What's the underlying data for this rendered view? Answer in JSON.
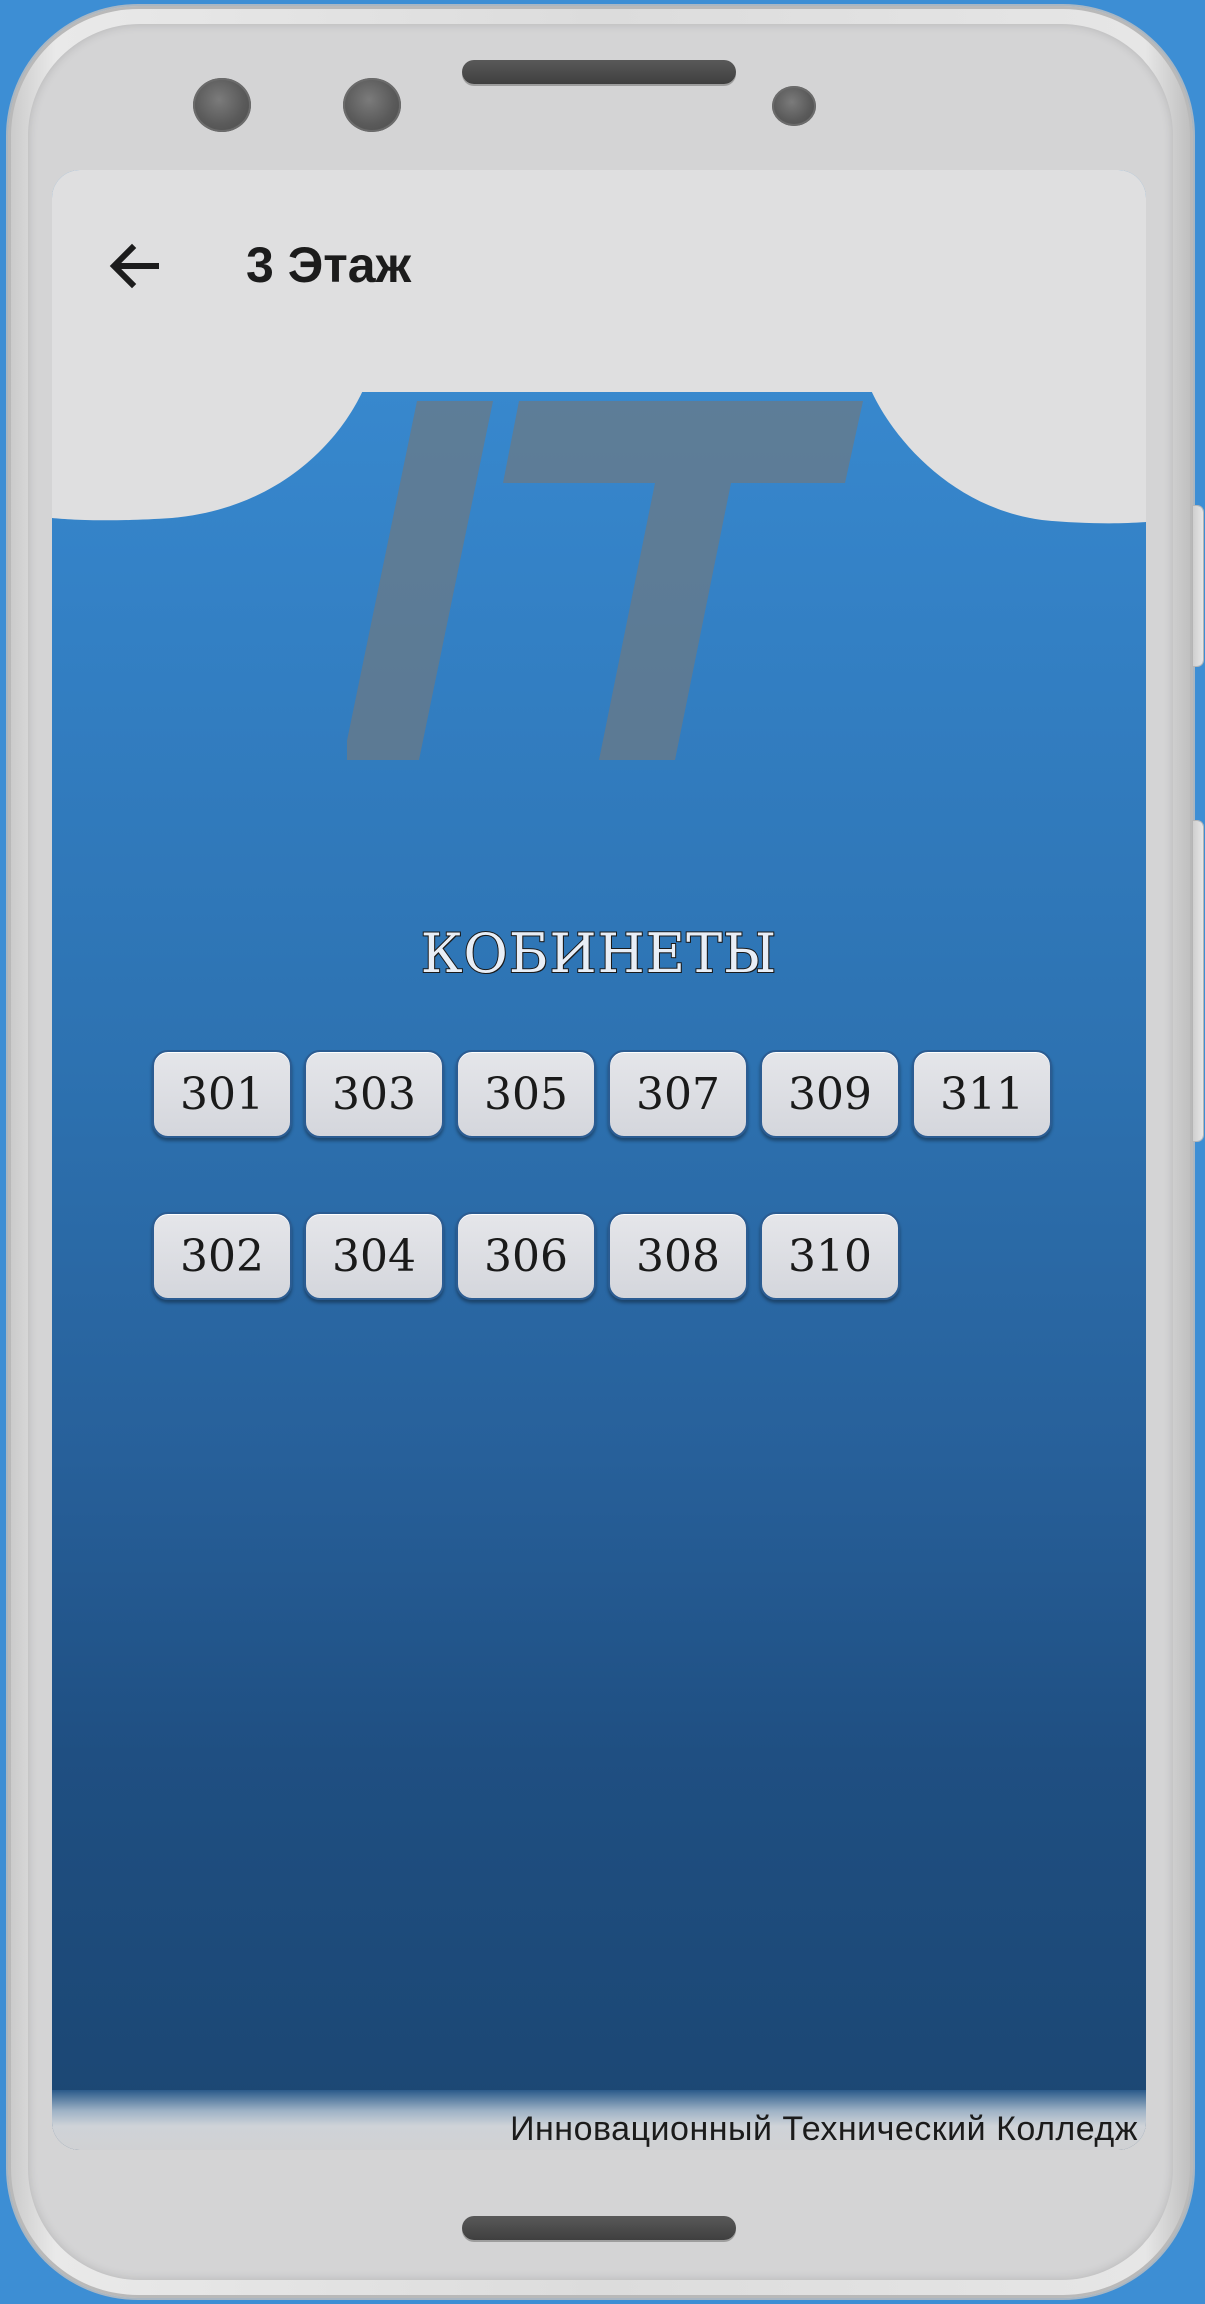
{
  "appbar": {
    "title": "3 Этаж",
    "back_icon": "arrow-left-icon"
  },
  "logo": {
    "text": "IT",
    "color": "#6b7a86"
  },
  "rooms": {
    "heading": "КОБИНЕТЫ",
    "odd": [
      "301",
      "303",
      "305",
      "307",
      "309",
      "311"
    ],
    "even": [
      "302",
      "304",
      "306",
      "308",
      "310"
    ]
  },
  "footer": {
    "college": "Инновационный Технический Колледж"
  },
  "colors": {
    "background": "#3d8ed4",
    "appbar": "#dfdfe0",
    "button_fill": "#dcdde2",
    "button_border": "#2b5c92"
  }
}
